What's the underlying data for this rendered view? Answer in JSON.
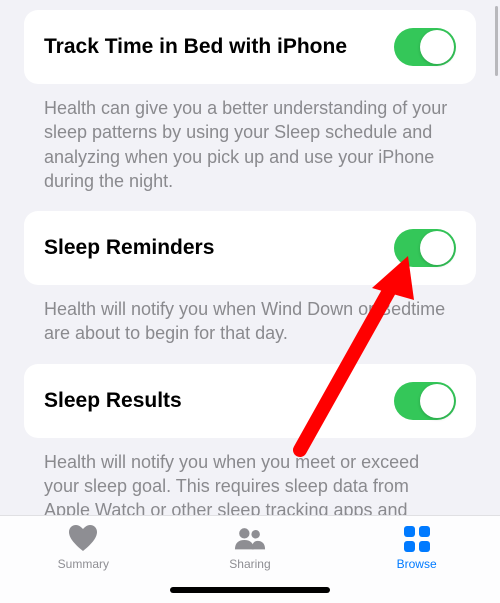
{
  "settings": [
    {
      "title": "Track Time in Bed with iPhone",
      "description": "Health can give you a better understanding of your sleep patterns by using your Sleep schedule and analyzing when you pick up and use your iPhone during the night.",
      "toggle": true
    },
    {
      "title": "Sleep Reminders",
      "description": "Health will notify you when Wind Down or Bedtime are about to begin for that day.",
      "toggle": true
    },
    {
      "title": "Sleep Results",
      "description": "Health will notify you when you meet or exceed your sleep goal. This requires sleep data from Apple Watch or other sleep tracking apps and hardware.",
      "toggle": true
    }
  ],
  "tabs": {
    "summary": "Summary",
    "sharing": "Sharing",
    "browse": "Browse"
  },
  "colors": {
    "toggle_on": "#34c759",
    "active_tab": "#007aff"
  }
}
